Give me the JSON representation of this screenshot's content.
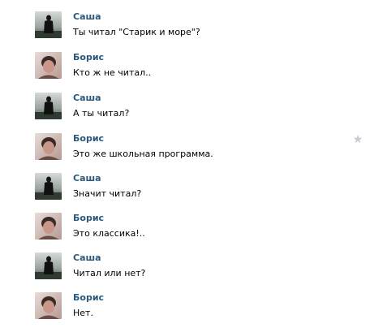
{
  "colors": {
    "author": "#2b587a",
    "text": "#000000",
    "star": "#c4cbd2"
  },
  "messages": [
    {
      "author": "Саша",
      "text": "Ты читал \"Старик и море\"?",
      "avatar": "sasha-avatar"
    },
    {
      "author": "Борис",
      "text": "Кто ж не читал..",
      "avatar": "boris-avatar"
    },
    {
      "author": "Саша",
      "text": "А ты читал?",
      "avatar": "sasha-avatar"
    },
    {
      "author": "Борис",
      "text": "Это же школьная программа.",
      "avatar": "boris-avatar",
      "starred_icon": "star-icon"
    },
    {
      "author": "Саша",
      "text": "Значит читал?",
      "avatar": "sasha-avatar"
    },
    {
      "author": "Борис",
      "text": "Это классика!..",
      "avatar": "boris-avatar"
    },
    {
      "author": "Саша",
      "text": "Читал или нет?",
      "avatar": "sasha-avatar"
    },
    {
      "author": "Борис",
      "text": "Нет.",
      "avatar": "boris-avatar"
    }
  ]
}
